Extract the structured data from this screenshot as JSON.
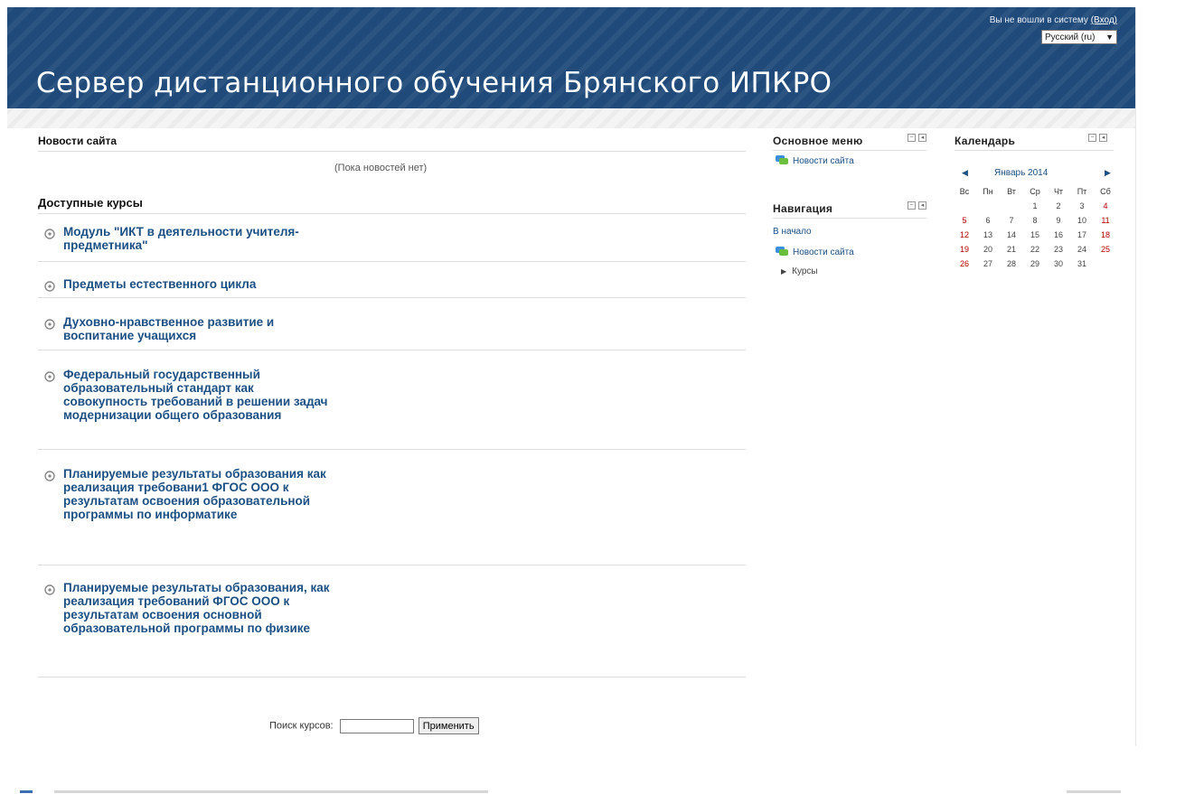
{
  "header": {
    "site_title": "Сервер дистанционного обучения Брянского ИПКРО",
    "login_text": "Вы не вошли в систему",
    "login_link": "(Вход)",
    "language": "Русский (ru)"
  },
  "news": {
    "title": "Новости сайта",
    "empty": "(Пока новостей нет)"
  },
  "courses": {
    "title": "Доступные курсы",
    "items": [
      "Модуль \"ИКТ в деятельности учителя-предметника\"",
      "Предметы естественного цикла",
      "Духовно-нравственное развитие и воспитание учащихся",
      "Федеральный государственный образовательный стандарт как совокупность требований в решении задач модернизации общего образования",
      "Планируемые результаты образования как реализация требовани1 ФГОС ООО к результатам освоения образовательной программы по информатике",
      "Планируемые результаты образования, как реализация требований ФГОС ООО к результатам освоения основной образовательной программы по физике"
    ]
  },
  "main_menu": {
    "title": "Основное меню",
    "items": [
      "Новости сайта"
    ]
  },
  "navigation": {
    "title": "Навигация",
    "home": "В начало",
    "news": "Новости сайта",
    "courses": "Курсы"
  },
  "calendar": {
    "title": "Календарь",
    "month": "Январь 2014",
    "weekdays": [
      "Вс",
      "Пн",
      "Вт",
      "Ср",
      "Чт",
      "Пт",
      "Сб"
    ],
    "weeks": [
      [
        "",
        "",
        "",
        "1",
        "2",
        "3",
        "4"
      ],
      [
        "5",
        "6",
        "7",
        "8",
        "9",
        "10",
        "11"
      ],
      [
        "12",
        "13",
        "14",
        "15",
        "16",
        "17",
        "18"
      ],
      [
        "19",
        "20",
        "21",
        "22",
        "23",
        "24",
        "25"
      ],
      [
        "26",
        "27",
        "28",
        "29",
        "30",
        "31",
        ""
      ]
    ]
  },
  "search": {
    "label": "Поиск курсов:",
    "value": "",
    "button": "Применить"
  }
}
